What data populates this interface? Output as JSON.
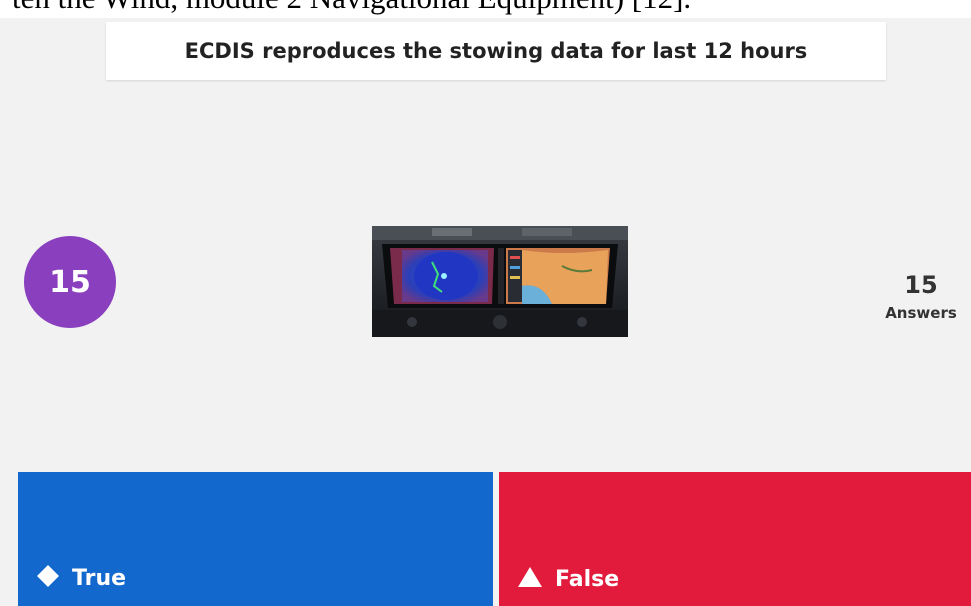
{
  "document": {
    "caption": "ten the Wind, module 2 Navigational Equipment) [12]."
  },
  "question": {
    "text": "ECDIS reproduces the stowing data for last 12 hours"
  },
  "timer": {
    "value": "15",
    "color": "#8a3fbf"
  },
  "media": {
    "icon": "ecdis-bridge-console-image"
  },
  "answers_count": {
    "value": "15",
    "label": "Answers"
  },
  "options": [
    {
      "label": "True",
      "icon": "diamond-icon",
      "color": "#1368ce"
    },
    {
      "label": "False",
      "icon": "triangle-icon",
      "color": "#e21b3c"
    }
  ]
}
